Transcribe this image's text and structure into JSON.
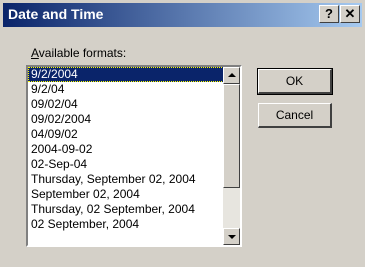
{
  "window": {
    "title": "Date and Time",
    "help_label": "?",
    "close_label": "✕"
  },
  "formats": {
    "label_prefix": "A",
    "label_rest": "vailable formats:",
    "selected_index": 0,
    "items": [
      "9/2/2004",
      "9/2/04",
      "09/02/04",
      "09/02/2004",
      "04/09/02",
      "2004-09-02",
      "02-Sep-04",
      "Thursday, September 02, 2004",
      "September 02, 2004",
      "Thursday, 02 September, 2004",
      "02 September, 2004"
    ]
  },
  "buttons": {
    "ok": "OK",
    "cancel": "Cancel"
  }
}
